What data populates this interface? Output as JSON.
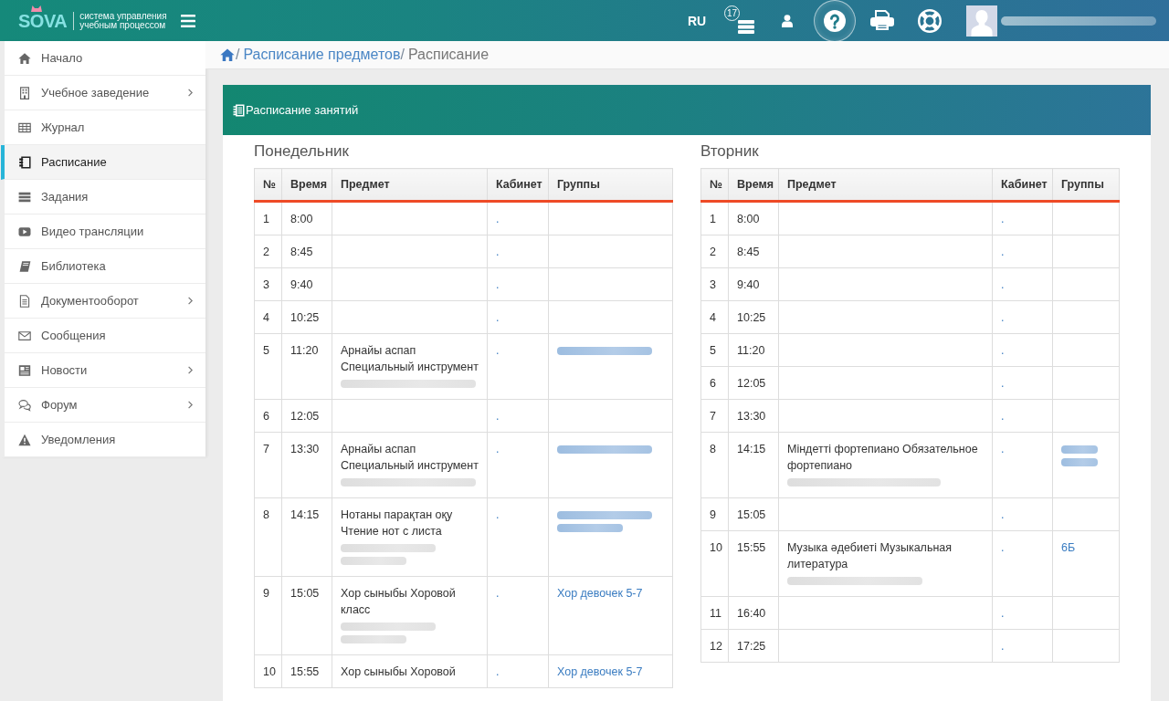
{
  "topbar": {
    "logo": {
      "wordmark": "SOVA",
      "tagline": [
        "система управления",
        "учебным процессом"
      ]
    },
    "language": "RU",
    "tools": [
      {
        "badge": "17",
        "highlighted": false
      },
      {
        "highlighted": false
      },
      {
        "highlighted": true
      },
      {
        "highlighted": false
      },
      {
        "highlighted": false
      }
    ],
    "user": {
      "name_blurred": true
    }
  },
  "sidebar": {
    "items": [
      {
        "label": "Начало",
        "has_submenu": false,
        "selected": false
      },
      {
        "label": "Учебное заведение",
        "has_submenu": true,
        "selected": false
      },
      {
        "label": "Журнал",
        "has_submenu": false,
        "selected": false
      },
      {
        "label": "Расписание",
        "has_submenu": false,
        "selected": true
      },
      {
        "label": "Задания",
        "has_submenu": false,
        "selected": false
      },
      {
        "label": "Видео трансляции",
        "has_submenu": false,
        "selected": false
      },
      {
        "label": "Библиотека",
        "has_submenu": false,
        "selected": false
      },
      {
        "label": "Документооборот",
        "has_submenu": true,
        "selected": false
      },
      {
        "label": "Сообщения",
        "has_submenu": false,
        "selected": false
      },
      {
        "label": "Новости",
        "has_submenu": true,
        "selected": false
      },
      {
        "label": "Форум",
        "has_submenu": true,
        "selected": false
      },
      {
        "label": "Уведомления",
        "has_submenu": false,
        "selected": false
      }
    ]
  },
  "breadcrumb": [
    {
      "separator": "/",
      "label": "Расписание предметов",
      "kind": "link"
    },
    {
      "separator": "/",
      "label": "Расписание",
      "kind": "current"
    }
  ],
  "card": {
    "title": "Расписание занятий",
    "days": [
      {
        "name": "Понедельник",
        "columns": [
          "№",
          "Время",
          "Предмет",
          "Кабинет",
          "Группы"
        ],
        "rows": [
          {
            "number": "1",
            "time": "8:00",
            "room": "."
          },
          {
            "number": "2",
            "time": "8:45",
            "room": "."
          },
          {
            "number": "3",
            "time": "9:40",
            "room": "."
          },
          {
            "number": "4",
            "time": "10:25",
            "room": "."
          },
          {
            "number": "5",
            "time": "11:20",
            "subject": "Арнайы аспап Специальный инструмент",
            "teacher": [
              {
                "kind": "long"
              }
            ],
            "room": ".",
            "groups": [
              {
                "kind": "medium"
              }
            ]
          },
          {
            "number": "6",
            "time": "12:05",
            "room": "."
          },
          {
            "number": "7",
            "time": "13:30",
            "subject": "Арнайы аспап Специальный инструмент",
            "teacher": [
              {
                "kind": "long"
              }
            ],
            "room": ".",
            "groups": [
              {
                "kind": "medium"
              }
            ]
          },
          {
            "number": "8",
            "time": "14:15",
            "subject": "Нотаны парақтан оқу Чтение нот с листа",
            "teacher": [
              {
                "kind": "medium"
              },
              {
                "kind": "short"
              }
            ],
            "room": ".",
            "groups": [
              {
                "kind": "medium"
              },
              {
                "kind": "short"
              }
            ]
          },
          {
            "number": "9",
            "time": "15:05",
            "subject": "Хор сыныбы Хоровой класс",
            "teacher": [
              {
                "kind": "medium"
              },
              {
                "kind": "short"
              }
            ],
            "room": ".",
            "groups": [
              {
                "kind": "link",
                "text": "Хор девочек 5-7"
              }
            ]
          },
          {
            "number": "10",
            "time": "15:55",
            "subject": "Хор сыныбы Хоровой",
            "room": ".",
            "groups": [
              {
                "kind": "link",
                "text": "Хор девочек 5-7"
              }
            ]
          }
        ]
      },
      {
        "name": "Вторник",
        "columns": [
          "№",
          "Время",
          "Предмет",
          "Кабинет",
          "Группы"
        ],
        "rows": [
          {
            "number": "1",
            "time": "8:00",
            "room": "."
          },
          {
            "number": "2",
            "time": "8:45",
            "room": "."
          },
          {
            "number": "3",
            "time": "9:40",
            "room": "."
          },
          {
            "number": "4",
            "time": "10:25",
            "room": "."
          },
          {
            "number": "5",
            "time": "11:20",
            "room": "."
          },
          {
            "number": "6",
            "time": "12:05",
            "room": "."
          },
          {
            "number": "7",
            "time": "13:30",
            "room": "."
          },
          {
            "number": "8",
            "time": "14:15",
            "subject": "Міндетті фортепиано Обязательное фортепиано",
            "teacher": [
              {
                "kind": "xlong"
              }
            ],
            "room": ".",
            "groups": [
              {
                "kind": "tiny"
              },
              {
                "kind": "tiny"
              }
            ]
          },
          {
            "number": "9",
            "time": "15:05",
            "room": "."
          },
          {
            "number": "10",
            "time": "15:55",
            "subject": "Музыка әдебиеті Музыкальная литература",
            "teacher": [
              {
                "kind": "long"
              }
            ],
            "room": ".",
            "groups": [
              {
                "kind": "link",
                "text": "6Б"
              }
            ]
          },
          {
            "number": "11",
            "time": "16:40",
            "room": "."
          },
          {
            "number": "12",
            "time": "17:25",
            "room": "."
          }
        ]
      }
    ]
  }
}
